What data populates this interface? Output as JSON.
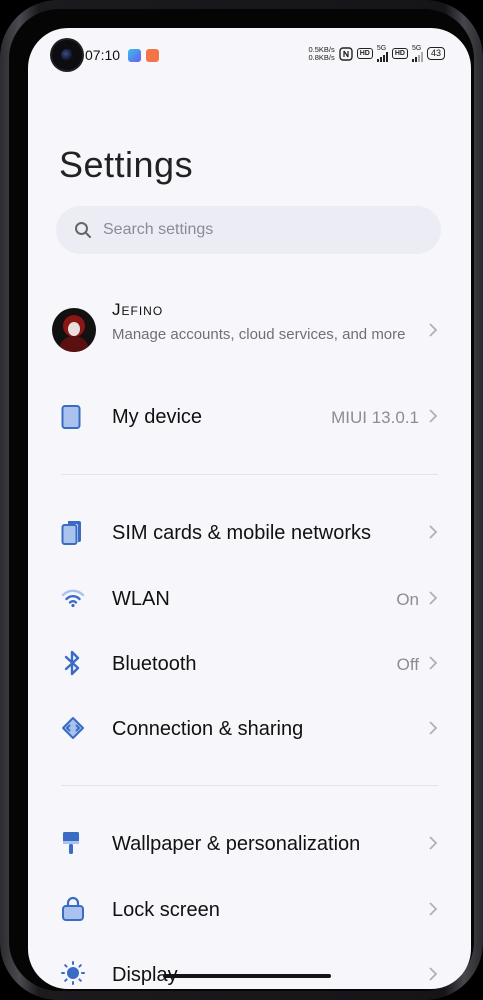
{
  "status_bar": {
    "time": "07:10",
    "net_up": "0.5KB/s",
    "net_down": "0.8KB/s",
    "hd_label": "HD",
    "network_type": "5G",
    "battery": "43"
  },
  "header": {
    "title": "Settings"
  },
  "search": {
    "placeholder": "Search settings"
  },
  "account": {
    "name": "Jefino",
    "description": "Manage accounts, cloud services, and more"
  },
  "items": {
    "my_device": {
      "label": "My device",
      "value": "MIUI 13.0.1",
      "icon": "phone-icon"
    },
    "sim": {
      "label": "SIM cards & mobile networks",
      "icon": "sim-card-icon"
    },
    "wlan": {
      "label": "WLAN",
      "value": "On",
      "icon": "wifi-icon"
    },
    "bluetooth": {
      "label": "Bluetooth",
      "value": "Off",
      "icon": "bluetooth-icon"
    },
    "connection": {
      "label": "Connection & sharing",
      "icon": "connection-icon"
    },
    "wallpaper": {
      "label": "Wallpaper & personalization",
      "icon": "brush-icon"
    },
    "lock_screen": {
      "label": "Lock screen",
      "icon": "lock-icon"
    },
    "display": {
      "label": "Display",
      "icon": "brightness-icon"
    }
  },
  "colors": {
    "icon_blue": "#3a6cc4",
    "background": "#f7f7fb",
    "search_bg": "#ececf5"
  }
}
